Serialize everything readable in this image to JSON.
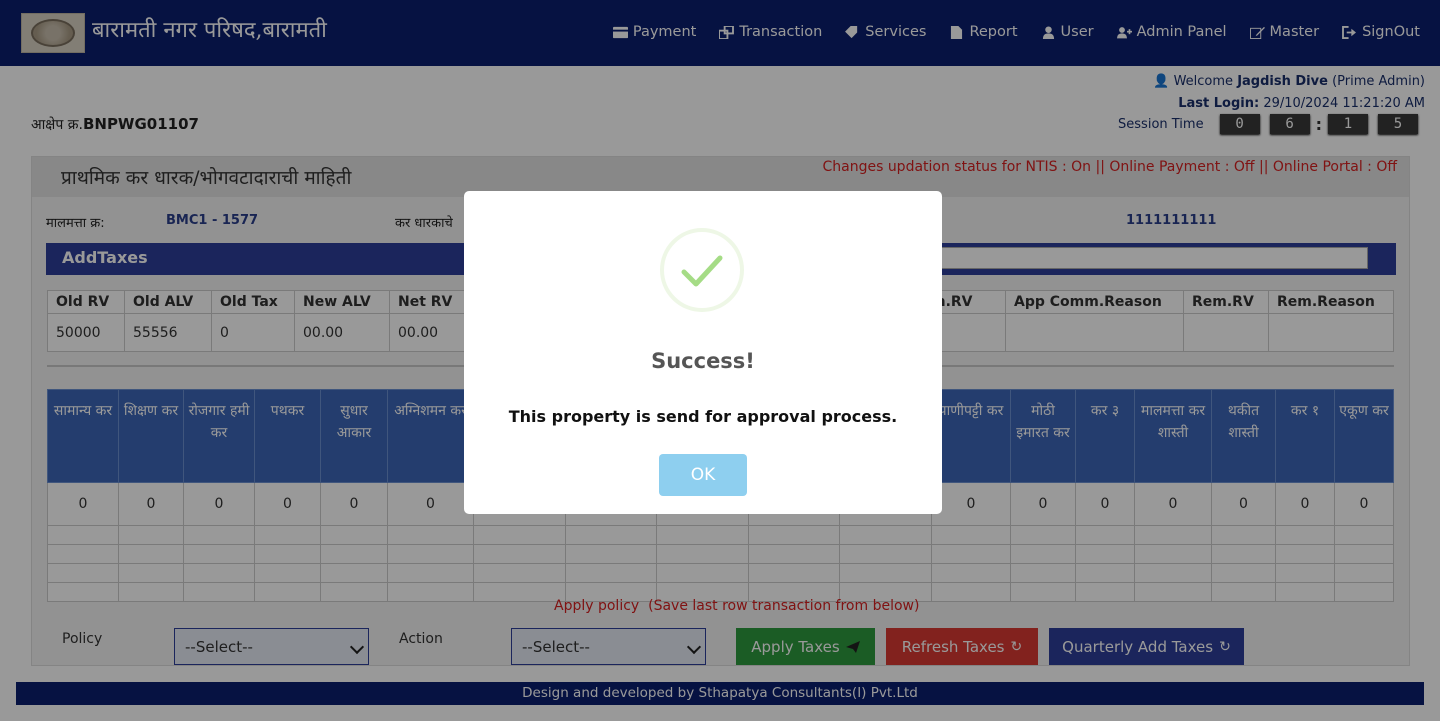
{
  "header": {
    "brand": "बारामती नगर परिषद,बारामती",
    "nav": [
      {
        "label": "Payment",
        "icon": "credit-card-icon"
      },
      {
        "label": "Transaction",
        "icon": "transfer-icon"
      },
      {
        "label": "Services",
        "icon": "tag-icon"
      },
      {
        "label": "Report",
        "icon": "file-icon"
      },
      {
        "label": "User",
        "icon": "user-icon"
      },
      {
        "label": "Admin Panel",
        "icon": "user-plus-icon"
      },
      {
        "label": "Master",
        "icon": "edit-icon"
      },
      {
        "label": "SignOut",
        "icon": "sign-out-icon"
      }
    ]
  },
  "user": {
    "welcome_prefix": "Welcome",
    "name": "Jagdish Dive",
    "role": "(Prime Admin)",
    "last_login_label": "Last Login:",
    "last_login_value": "29/10/2024 11:21:20 AM",
    "session_label": "Session Time",
    "session_digits": [
      "0",
      "6",
      "1",
      "5"
    ]
  },
  "objection": {
    "label": "आक्षेप क्र.",
    "value": "BNPWG01107"
  },
  "section": {
    "title": "प्राथमिक कर धारक/भोगवटादाराची माहिती",
    "status": "Changes updation status for NTIS : On || Online Payment : Off || Online Portal : Off",
    "property_label": "मालमत्ता क्र:",
    "property_value": "BMC1 - 1577",
    "holder_label": "कर धारकाचे",
    "phone_value": "1111111111"
  },
  "addtaxes": {
    "title": "AddTaxes"
  },
  "summary_table": {
    "headers": [
      "Old RV",
      "Old ALV",
      "Old Tax",
      "New ALV",
      "Net RV",
      "",
      "",
      "",
      "",
      "",
      "m.RV",
      "App Comm.Reason",
      "Rem.RV",
      "Rem.Reason"
    ],
    "row": [
      "50000",
      "55556",
      "0",
      "00.00",
      "00.00",
      "",
      "",
      "",
      "",
      "",
      "",
      "",
      "",
      ""
    ]
  },
  "tax_table": {
    "headers": [
      "सामान्य कर",
      "शिक्षण कर",
      "रोजगार हमी कर",
      "पथकर",
      "सुधार आकार",
      "अग्निशमन कर",
      "",
      "",
      "",
      "",
      "",
      "पाणीपट्टी कर",
      "मोठी इमारत कर",
      "कर ३",
      "मालमत्ता कर शास्ती",
      "थकीत शास्ती",
      "कर १",
      "एकूण कर"
    ],
    "row": [
      "0",
      "0",
      "0",
      "0",
      "0",
      "0",
      "",
      "",
      "",
      "",
      "",
      "0",
      "0",
      "0",
      "0",
      "0",
      "0",
      "0"
    ]
  },
  "policy": {
    "apply_policy": "Apply policy",
    "apply_note": "(Save last row transaction from below)",
    "policy_label": "Policy",
    "action_label": "Action",
    "policy_select": "--Select--",
    "action_select": "--Select--",
    "apply_taxes": "Apply Taxes",
    "refresh_taxes": "Refresh Taxes",
    "quarterly_add_taxes": "Quarterly Add Taxes"
  },
  "footer": {
    "text": "Design and developed by Sthapatya Consultants(I) Pvt.Ltd"
  },
  "modal": {
    "title": "Success!",
    "message": "This property is send for approval process.",
    "ok": "OK"
  },
  "colors": {
    "header": "#0b1e6e",
    "accent": "#2e3f99",
    "table_header": "#3c66b8",
    "apply_green": "#2e9a3e",
    "refresh_red": "#d93a32",
    "ok_blue": "#8ecfef",
    "check_green": "#a5dc86"
  }
}
